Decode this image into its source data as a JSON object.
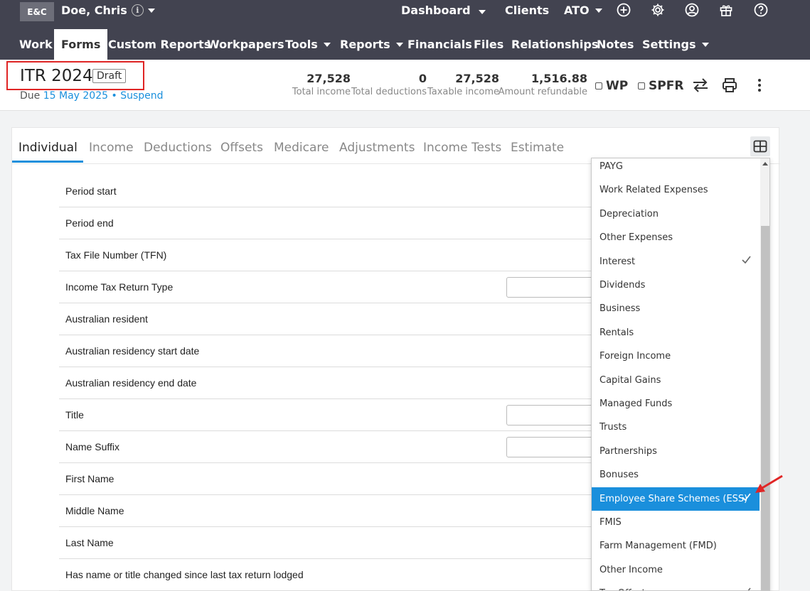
{
  "topbar": {
    "logo": "E&C",
    "client_name": "Doe, Chris",
    "info_glyph": "i",
    "links": {
      "dashboard": "Dashboard",
      "clients": "Clients",
      "ato": "ATO"
    }
  },
  "nav": {
    "items": [
      "Work",
      "Forms",
      "Custom Reports",
      "Workpapers",
      "Tools",
      "Reports",
      "Financials",
      "Files",
      "Relationships",
      "Notes",
      "Settings"
    ],
    "active": "Forms"
  },
  "header": {
    "title": "ITR 2024",
    "status": "Draft",
    "due_prefix": "Due",
    "due_date": "15 May 2025",
    "separator": "•",
    "suspend": "Suspend",
    "stats": [
      {
        "value": "27,528",
        "label": "Total income"
      },
      {
        "value": "0",
        "label": "Total deductions"
      },
      {
        "value": "27,528",
        "label": "Taxable income"
      },
      {
        "value": "1,516.88",
        "label": "Amount refundable"
      }
    ],
    "checks": {
      "wp": "WP",
      "spfr": "SPFR"
    }
  },
  "tabs": [
    "Individual",
    "Income",
    "Deductions",
    "Offsets",
    "Medicare",
    "Adjustments",
    "Income Tests",
    "Estimate"
  ],
  "form_rows": [
    "Period start",
    "Period end",
    "Tax File Number (TFN)",
    "Income Tax Return Type",
    "Australian resident",
    "Australian residency start date",
    "Australian residency end date",
    "Title",
    "Name Suffix",
    "First Name",
    "Middle Name",
    "Last Name",
    "Has name or title changed since last tax return lodged"
  ],
  "dropdown": {
    "items": [
      {
        "label": "PAYG",
        "checked": false
      },
      {
        "label": "Work Related Expenses",
        "checked": false
      },
      {
        "label": "Depreciation",
        "checked": false
      },
      {
        "label": "Other Expenses",
        "checked": false
      },
      {
        "label": "Interest",
        "checked": true
      },
      {
        "label": "Dividends",
        "checked": false
      },
      {
        "label": "Business",
        "checked": false
      },
      {
        "label": "Rentals",
        "checked": false
      },
      {
        "label": "Foreign Income",
        "checked": false
      },
      {
        "label": "Capital Gains",
        "checked": false
      },
      {
        "label": "Managed Funds",
        "checked": false
      },
      {
        "label": "Trusts",
        "checked": false
      },
      {
        "label": "Partnerships",
        "checked": false
      },
      {
        "label": "Bonuses",
        "checked": false
      },
      {
        "label": "Employee Share Schemes (ESS)",
        "checked": true,
        "selected": true
      },
      {
        "label": "FMIS",
        "checked": false
      },
      {
        "label": "Farm Management (FMD)",
        "checked": false
      },
      {
        "label": "Other Income",
        "checked": false
      },
      {
        "label": "Tax Offsets",
        "checked": true
      }
    ],
    "check_glyph": "✓"
  },
  "colors": {
    "bar": "#424350",
    "accent": "#1a8fdc",
    "highlight_border": "#e02525"
  }
}
